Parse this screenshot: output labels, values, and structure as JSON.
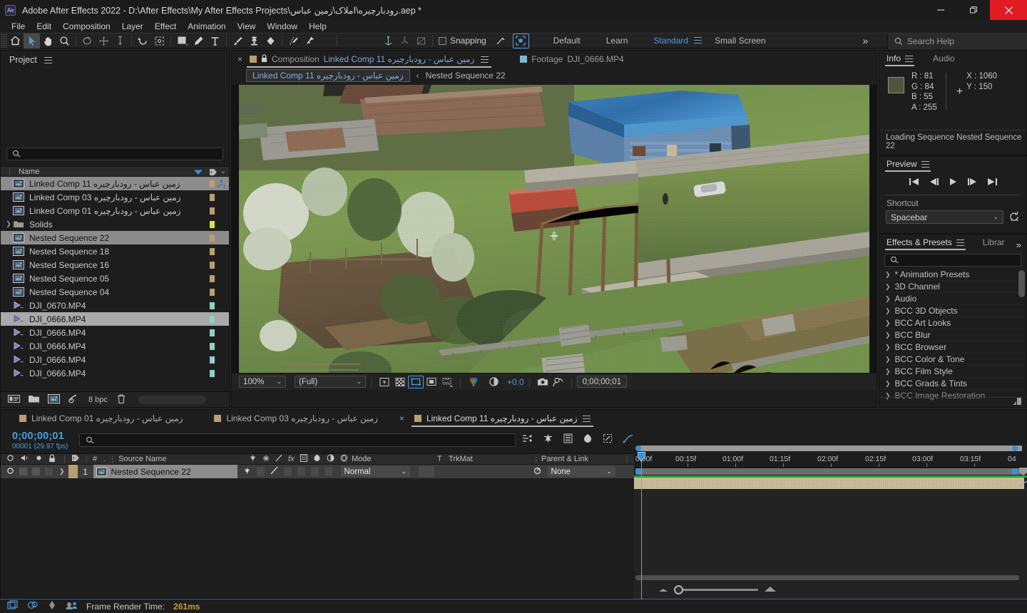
{
  "window": {
    "title": "Adobe After Effects 2022 - D:\\After Effects\\My After Effects Projects\\رودبارچیره\\املاک\\زمین عباس.aep *",
    "logo": "Ae",
    "minimize": "minimize-icon",
    "maximize": "restore-icon",
    "close": "close-icon"
  },
  "menu": {
    "items": [
      "File",
      "Edit",
      "Composition",
      "Layer",
      "Effect",
      "Animation",
      "View",
      "Window",
      "Help"
    ]
  },
  "toolbar": {
    "tools": [
      {
        "name": "home-icon",
        "selected": false
      },
      {
        "name": "selection-tool-icon",
        "selected": true
      },
      {
        "name": "hand-tool-icon",
        "selected": false
      },
      {
        "name": "zoom-tool-icon",
        "selected": false
      },
      {
        "name": "orbit-camera-tool-icon",
        "selected": false
      },
      {
        "name": "pan-camera-tool-icon",
        "selected": false
      },
      {
        "name": "dolly-camera-tool-icon",
        "selected": false
      },
      {
        "name": "rotation-tool-icon",
        "selected": false
      },
      {
        "name": "anchor-point-tool-icon",
        "selected": false
      },
      {
        "name": "rectangle-tool-icon",
        "selected": false
      },
      {
        "name": "pen-tool-icon",
        "selected": false
      },
      {
        "name": "type-tool-icon",
        "selected": false
      },
      {
        "name": "brush-tool-icon",
        "selected": false
      },
      {
        "name": "clone-stamp-tool-icon",
        "selected": false
      },
      {
        "name": "eraser-tool-icon",
        "selected": false
      },
      {
        "name": "roto-brush-tool-icon",
        "selected": false
      },
      {
        "name": "puppet-pin-tool-icon",
        "selected": false
      },
      {
        "name": "unified-camera-icon",
        "selected": false
      },
      {
        "name": "orbit-null-icon",
        "selected": false
      },
      {
        "name": "null-transform-icon",
        "selected": false
      }
    ],
    "snapping_label": "Snapping",
    "snapping_checked": false
  },
  "workspaces": {
    "items": [
      {
        "label": "Default",
        "active": false
      },
      {
        "label": "Learn",
        "active": false
      },
      {
        "label": "Standard",
        "active": true
      },
      {
        "label": "Small Screen",
        "active": false
      }
    ],
    "overflow": "»"
  },
  "search_help": {
    "placeholder": "Search Help",
    "icon": "search-icon"
  },
  "project": {
    "tab_label": "Project",
    "menu_icon": "panel-menu-icon",
    "search_icon": "search-icon",
    "column_header": "Name",
    "sort_icon": "sort-descending-icon",
    "label_icon": "label-color-icon",
    "items": [
      {
        "label": "زمین عباس - رودبارچیره Linked Comp 11",
        "type": "comp",
        "selected": true,
        "swatch": "#b99f6f",
        "linked": true,
        "rtl": true
      },
      {
        "label": "زمین عباس - رودبارچیره Linked Comp 03",
        "type": "comp",
        "selected": false,
        "swatch": "#b99f6f",
        "linked": false,
        "rtl": true
      },
      {
        "label": "زمین عباس - رودبارچیره Linked Comp 01",
        "type": "comp",
        "selected": false,
        "swatch": "#b99f6f",
        "linked": false,
        "rtl": true
      },
      {
        "label": "Solids",
        "type": "folder",
        "selected": false,
        "swatch": "#e0e040",
        "linked": false,
        "rtl": false
      },
      {
        "label": "Nested Sequence 22",
        "type": "comp",
        "selected": true,
        "swatch": "#b99f6f",
        "linked": false,
        "rtl": false
      },
      {
        "label": "Nested Sequence 18",
        "type": "comp",
        "selected": false,
        "swatch": "#b99f6f",
        "linked": false,
        "rtl": false
      },
      {
        "label": "Nested Sequence 16",
        "type": "comp",
        "selected": false,
        "swatch": "#b99f6f",
        "linked": false,
        "rtl": false
      },
      {
        "label": "Nested Sequence 05",
        "type": "comp",
        "selected": false,
        "swatch": "#b99f6f",
        "linked": false,
        "rtl": false
      },
      {
        "label": "Nested Sequence 04",
        "type": "comp",
        "selected": false,
        "swatch": "#b99f6f",
        "linked": false,
        "rtl": false
      },
      {
        "label": "DJI_0670.MP4",
        "type": "footage",
        "selected": false,
        "swatch": "#8fd0c8",
        "linked": false,
        "rtl": false
      },
      {
        "label": "DJI_0666.MP4",
        "type": "footage",
        "selected": true,
        "swatch": "#8fd0c8",
        "linked": false,
        "rtl": false
      },
      {
        "label": "DJI_0666.MP4",
        "type": "footage",
        "selected": false,
        "swatch": "#8fd0c8",
        "linked": false,
        "rtl": false
      },
      {
        "label": "DJI_0666.MP4",
        "type": "footage",
        "selected": false,
        "swatch": "#8fd0c8",
        "linked": false,
        "rtl": false
      },
      {
        "label": "DJI_0666.MP4",
        "type": "footage",
        "selected": false,
        "swatch": "#8fd0c8",
        "linked": false,
        "rtl": false
      },
      {
        "label": "DJI_0666.MP4",
        "type": "footage",
        "selected": false,
        "swatch": "#8fd0c8",
        "linked": false,
        "rtl": false
      }
    ],
    "footer": {
      "interpret_footage": "interpret-footage-icon",
      "new_folder": "new-folder-icon",
      "new_comp": "new-composition-icon",
      "project_settings": "project-settings-icon",
      "bit_depth": "8 bpc",
      "delete": "trash-icon"
    }
  },
  "composition": {
    "tabs": [
      {
        "close": "×",
        "lock": "lock-icon",
        "prefix": "Composition",
        "title": "زمین عباس - رودبارچیره Linked Comp 11",
        "active": true,
        "menu": "panel-menu-icon"
      },
      {
        "prefix": "Footage",
        "title": "DJI_0666.MP4",
        "active": false
      }
    ],
    "breadcrumb": {
      "current": "زمین عباس - رودبارچیره Linked Comp 11",
      "separator": "‹",
      "next": "Nested Sequence 22"
    },
    "viewer_bar": {
      "magnification": "100%",
      "resolution": "(Full)",
      "buttons": [
        {
          "name": "fast-previews-icon",
          "on": false
        },
        {
          "name": "transparency-grid-icon",
          "on": false
        },
        {
          "name": "region-of-interest-icon",
          "on": true
        },
        {
          "name": "proportional-grid-icon",
          "on": false
        },
        {
          "name": "mask-guide-layers-icon",
          "on": false
        },
        {
          "name": "channel-rgb-icon",
          "on": false
        },
        {
          "name": "exposure-reset-icon",
          "on": false
        }
      ],
      "exposure": "+0.0",
      "snapshot_icon": "camera-icon",
      "show_snapshot_icon": "show-snapshot-icon",
      "timecode": "0;00;00;01"
    },
    "anchor_icon": "anchor-point-icon"
  },
  "info_panel": {
    "tabs": [
      {
        "label": "Info",
        "active": true
      },
      {
        "label": "Audio",
        "active": false
      }
    ],
    "menu_icon": "panel-menu-icon",
    "color_swatch": "#51543a",
    "channels": [
      {
        "key": "R :",
        "value": "81"
      },
      {
        "key": "G :",
        "value": "84"
      },
      {
        "key": "B :",
        "value": "55"
      },
      {
        "key": "A :",
        "value": "255"
      }
    ],
    "coords": [
      {
        "key": "X :",
        "value": "1060"
      },
      {
        "key": "Y :",
        "value": "150"
      }
    ],
    "status": "Loading Sequence Nested Sequence 22"
  },
  "preview_panel": {
    "tab_label": "Preview",
    "menu_icon": "panel-menu-icon",
    "transport": [
      "first-frame-icon",
      "previous-frame-icon",
      "play-icon",
      "next-frame-icon",
      "last-frame-icon"
    ],
    "shortcut_label": "Shortcut",
    "shortcut_value": "Spacebar",
    "reset_icon": "reset-icon"
  },
  "effects_panel": {
    "tabs": [
      {
        "label": "Effects & Presets",
        "active": true
      },
      {
        "label": "Librar",
        "active": false
      }
    ],
    "menu_icon": "panel-menu-icon",
    "overflow": "»",
    "search_icon": "search-icon",
    "categories": [
      "* Animation Presets",
      "3D Channel",
      "Audio",
      "BCC 3D Objects",
      "BCC Art Looks",
      "BCC Blur",
      "BCC Browser",
      "BCC Color & Tone",
      "BCC Film Style",
      "BCC Grads & Tints",
      "BCC Image Restoration"
    ]
  },
  "timeline": {
    "tabs": [
      {
        "label": "زمین عباس - رودبارچیره Linked Comp 01",
        "active": false
      },
      {
        "label": "زمین عباس - رودبارچیره Linked Comp 03",
        "active": false
      },
      {
        "label": "زمین عباس - رودبارچیره Linked Comp 11",
        "active": true,
        "close": "×",
        "menu": "panel-menu-icon"
      }
    ],
    "current_time": "0;00;00;01",
    "frame_info": "00001 (29.97 fps)",
    "search_icon": "search-icon",
    "tool_icons": [
      "composition-mini-flowchart-icon",
      "draft-3d-icon",
      "hide-shy-layers-icon",
      "frame-blending-icon",
      "motion-blur-icon",
      "graph-editor-icon"
    ],
    "columns": [
      "Source Name",
      "Mode",
      "T",
      "TrkMat",
      "Parent & Link"
    ],
    "column_toggles": [
      "video-icon",
      "audio-icon",
      "solo-icon",
      "lock-icon"
    ],
    "switch_icons": [
      "shy-icon",
      "collapse-icon",
      "quality-icon",
      "effects-icon",
      "frame-blend-icon",
      "motion-blur-icon",
      "adjustment-icon",
      "3d-icon"
    ],
    "layers": [
      {
        "index": "1",
        "name": "Nested Sequence 22",
        "mode": "Normal",
        "track_matte": "",
        "parent": "None",
        "selected": true,
        "label_color": "#b99f6f"
      }
    ],
    "ruler_ticks": [
      "0;00f",
      "00:15f",
      "01:00f",
      "01:15f",
      "02:00f",
      "02:15f",
      "03:00f",
      "03:15f",
      "04"
    ],
    "zoom_out_icon": "zoom-out-icon",
    "zoom_in_icon": "zoom-in-icon"
  },
  "statusbar": {
    "icons": [
      "render-queue-icon",
      "sync-settings-icon",
      "adaptive-resolution-icon",
      "team-projects-icon"
    ],
    "label": "Frame Render Time:",
    "value": "261ms"
  },
  "colors": {
    "accent_blue": "#4d9ddb",
    "label_tan": "#b99f6f",
    "label_teal": "#8fd0c8",
    "close_red": "#e11b22",
    "render_orange": "#c79a3e"
  }
}
